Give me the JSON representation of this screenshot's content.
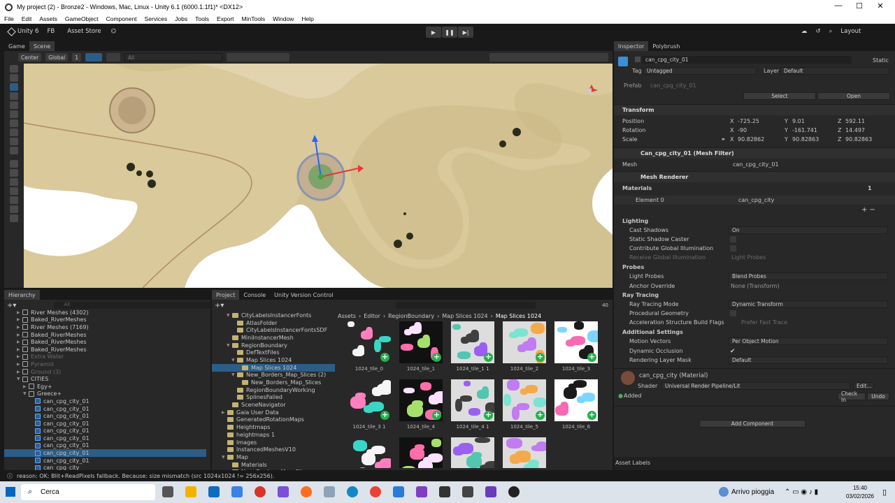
{
  "window": {
    "title": "My project (2) - Bronze2 - Windows, Mac, Linux - Unity 6.1 (6000.1.1f1)* <DX12>",
    "minimize": "—",
    "maximize": "☐",
    "close": "✕"
  },
  "menu": [
    "File",
    "Edit",
    "Assets",
    "GameObject",
    "Component",
    "Services",
    "Jobs",
    "Tools",
    "Export",
    "MinTools",
    "Window",
    "Help"
  ],
  "toolbar": {
    "account": "Unity 6",
    "fb": "FB",
    "store": "Asset Store",
    "layout": "Layout"
  },
  "scene": {
    "tabs": [
      "Game",
      "Scene"
    ],
    "pivot": "Center",
    "space": "Global",
    "grid_step": "1",
    "search_placeholder": "All"
  },
  "hierarchy": {
    "title": "Hierarchy",
    "search_placeholder": "All",
    "items": [
      {
        "label": "River Meshes (4302)",
        "indent": 2,
        "icon": "cube",
        "fold": "▶"
      },
      {
        "label": "Baked_RiverMeshes",
        "indent": 2,
        "icon": "cube",
        "fold": "▶"
      },
      {
        "label": "River Meshes (7169)",
        "indent": 2,
        "icon": "cube",
        "fold": "▶"
      },
      {
        "label": "Baked_RiverMeshes",
        "indent": 2,
        "icon": "cube",
        "fold": "▶"
      },
      {
        "label": "Baked_RiverMeshes",
        "indent": 2,
        "icon": "cube",
        "fold": "▶"
      },
      {
        "label": "Baked_RiverMeshes",
        "indent": 2,
        "icon": "cube",
        "fold": "▶"
      },
      {
        "label": "Extra Water",
        "indent": 2,
        "icon": "cube",
        "fold": "▶",
        "dim": true
      },
      {
        "label": "Pyramid",
        "indent": 2,
        "icon": "cube",
        "fold": "▶",
        "dim": true
      },
      {
        "label": "Ground (3)",
        "indent": 2,
        "icon": "cube",
        "fold": "▶",
        "dim": true
      },
      {
        "label": "CITIES",
        "indent": 2,
        "icon": "cube",
        "fold": "▼"
      },
      {
        "label": "Egy+",
        "indent": 3,
        "icon": "cube",
        "fold": "▶"
      },
      {
        "label": "Greece+",
        "indent": 3,
        "icon": "cube",
        "fold": "▼"
      },
      {
        "label": "can_cpg_city_01",
        "indent": 4,
        "icon": "blue",
        "fold": ""
      },
      {
        "label": "can_cpg_city_01",
        "indent": 4,
        "icon": "blue",
        "fold": ""
      },
      {
        "label": "can_cpg_city_01",
        "indent": 4,
        "icon": "blue",
        "fold": ""
      },
      {
        "label": "can_cpg_city_01",
        "indent": 4,
        "icon": "blue",
        "fold": ""
      },
      {
        "label": "can_cpg_city_01",
        "indent": 4,
        "icon": "blue",
        "fold": ""
      },
      {
        "label": "can_cpg_city_01",
        "indent": 4,
        "icon": "blue",
        "fold": ""
      },
      {
        "label": "can_cpg_city_01",
        "indent": 4,
        "icon": "blue",
        "fold": ""
      },
      {
        "label": "can_cpg_city_01",
        "indent": 4,
        "icon": "blue",
        "fold": "",
        "selected": true
      },
      {
        "label": "can_cpg_city_01",
        "indent": 4,
        "icon": "blue",
        "fold": ""
      },
      {
        "label": "can_cpg_city",
        "indent": 4,
        "icon": "blue",
        "fold": ""
      }
    ]
  },
  "project": {
    "tabs": [
      "Project",
      "Console",
      "Unity Version Control"
    ],
    "count": "40",
    "breadcrumb": [
      "Assets",
      "Editor",
      "RegionBoundary",
      "Map Slices 1024",
      "Map Slices 1024"
    ],
    "tree": [
      {
        "label": "CityLabelsInstancerFonts",
        "indent": 3,
        "fold": "▼"
      },
      {
        "label": "AtlasFolder",
        "indent": 4,
        "fold": ""
      },
      {
        "label": "CityLabelsInstancerFontsSDF",
        "indent": 4,
        "fold": ""
      },
      {
        "label": "MiniInstancerMesh",
        "indent": 3,
        "fold": ""
      },
      {
        "label": "RegionBoundary",
        "indent": 3,
        "fold": "▼"
      },
      {
        "label": "DefTextFiles",
        "indent": 4,
        "fold": ""
      },
      {
        "label": "Map Slices 1024",
        "indent": 4,
        "fold": "▼"
      },
      {
        "label": "Map Slices 1024",
        "indent": 5,
        "fold": "",
        "selected": true
      },
      {
        "label": "New_Borders_Map_Slices (2)",
        "indent": 4,
        "fold": "▼"
      },
      {
        "label": "New_Borders_Map_Slices",
        "indent": 5,
        "fold": ""
      },
      {
        "label": "RegionBoundaryWorking",
        "indent": 4,
        "fold": ""
      },
      {
        "label": "SplinesFailed",
        "indent": 4,
        "fold": ""
      },
      {
        "label": "SceneNavigator",
        "indent": 3,
        "fold": ""
      },
      {
        "label": "Gaia User Data",
        "indent": 2,
        "fold": "▶"
      },
      {
        "label": "GeneratedRotationMaps",
        "indent": 2,
        "fold": ""
      },
      {
        "label": "Heightmaps",
        "indent": 2,
        "fold": ""
      },
      {
        "label": "heightmaps 1",
        "indent": 2,
        "fold": ""
      },
      {
        "label": "Images",
        "indent": 2,
        "fold": ""
      },
      {
        "label": "InstancedMeshesV10",
        "indent": 2,
        "fold": ""
      },
      {
        "label": "Map",
        "indent": 2,
        "fold": "▼"
      },
      {
        "label": "Materials",
        "indent": 3,
        "fold": ""
      },
      {
        "label": "New_Borders_Map_Slices",
        "indent": 3,
        "fold": ""
      }
    ],
    "assets": [
      "1024_tile_0",
      "1024_tile_1",
      "1024_tile_1 1",
      "1024_tile_2",
      "1024_tile_3",
      "1024_tile_3 1",
      "1024_tile_4",
      "1024_tile_4 1",
      "1024_tile_5",
      "1024_tile_6",
      "",
      "",
      "",
      ""
    ]
  },
  "inspector": {
    "tabs": [
      "Inspector",
      "Polybrush"
    ],
    "name": "can_cpg_city_01",
    "static": "Static",
    "tag_label": "Tag",
    "tag": "Untagged",
    "layer_label": "Layer",
    "layer": "Default",
    "prefab_label": "Prefab",
    "prefab": "can_cpg_city_01",
    "select": "Select",
    "open": "Open",
    "transform": {
      "title": "Transform",
      "position_label": "Position",
      "position": [
        "-725.25",
        "9.01",
        "592.11"
      ],
      "rotation_label": "Rotation",
      "rotation": [
        "-90",
        "-161.741",
        "14.497"
      ],
      "scale_label": "Scale",
      "scale": [
        "90.82862",
        "90.82863",
        "90.82863"
      ],
      "axes": [
        "X",
        "Y",
        "Z"
      ]
    },
    "mesh_filter": {
      "title": "Can_cpg_city_01 (Mesh Filter)",
      "mesh_label": "Mesh",
      "mesh": "can_cpg_city_01"
    },
    "mesh_renderer": {
      "title": "Mesh Renderer",
      "materials": "Materials",
      "materials_count": "1",
      "element0": "Element 0",
      "element0_value": "can_cpg_city",
      "lighting": "Lighting",
      "cast_shadows": "Cast Shadows",
      "cast_shadows_value": "On",
      "static_shadow": "Static Shadow Caster",
      "contribute_gi": "Contribute Global Illumination",
      "receive_gi": "Receive Global Illumination",
      "receive_gi_value": "Light Probes",
      "probes": "Probes",
      "light_probes": "Light Probes",
      "light_probes_value": "Blend Probes",
      "anchor": "Anchor Override",
      "anchor_value": "None (Transform)",
      "ray_tracing": "Ray Tracing",
      "rt_mode": "Ray Tracing Mode",
      "rt_mode_value": "Dynamic Transform",
      "proc_geo": "Procedural Geometry",
      "accel": "Acceleration Structure Build Flags",
      "accel_value": "Prefer Fast Trace",
      "additional": "Additional Settings",
      "motion": "Motion Vectors",
      "motion_value": "Per Object Motion",
      "dyn_occ": "Dynamic Occlusion",
      "render_mask": "Rendering Layer Mask",
      "render_mask_value": "Default"
    },
    "material": {
      "title": "can_cpg_city (Material)",
      "shader_label": "Shader",
      "shader": "Universal Render Pipeline/Lit",
      "edit": "Edit...",
      "added": "Added",
      "checkin": "Check In",
      "undo": "Undo"
    },
    "add_component": "Add Component",
    "asset_labels": "Asset Labels"
  },
  "status": {
    "message": "reason: OK: Blit+ReadPixels fallback. Because: size mismatch (src 1024x1024 != 256x256)."
  },
  "taskbar": {
    "search": "Cerca",
    "weather": "Arrivo pioggia",
    "time": "15:40",
    "date": "03/02/2026"
  },
  "colors": {
    "accent": "#2c5d87",
    "selection": "#2c5d87",
    "terrain": "#d2c191",
    "water": "#ffffff"
  }
}
